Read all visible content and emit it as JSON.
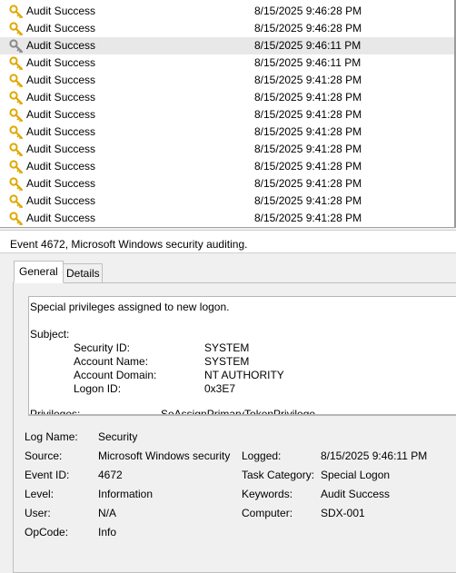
{
  "events": [
    {
      "keyword": "Audit Success",
      "datetime": "8/15/2025 9:46:28 PM"
    },
    {
      "keyword": "Audit Success",
      "datetime": "8/15/2025 9:46:28 PM"
    },
    {
      "keyword": "Audit Success",
      "datetime": "8/15/2025 9:46:11 PM",
      "selected": true
    },
    {
      "keyword": "Audit Success",
      "datetime": "8/15/2025 9:46:11 PM"
    },
    {
      "keyword": "Audit Success",
      "datetime": "8/15/2025 9:41:28 PM"
    },
    {
      "keyword": "Audit Success",
      "datetime": "8/15/2025 9:41:28 PM"
    },
    {
      "keyword": "Audit Success",
      "datetime": "8/15/2025 9:41:28 PM"
    },
    {
      "keyword": "Audit Success",
      "datetime": "8/15/2025 9:41:28 PM"
    },
    {
      "keyword": "Audit Success",
      "datetime": "8/15/2025 9:41:28 PM"
    },
    {
      "keyword": "Audit Success",
      "datetime": "8/15/2025 9:41:28 PM"
    },
    {
      "keyword": "Audit Success",
      "datetime": "8/15/2025 9:41:28 PM"
    },
    {
      "keyword": "Audit Success",
      "datetime": "8/15/2025 9:41:28 PM"
    },
    {
      "keyword": "Audit Success",
      "datetime": "8/15/2025 9:41:28 PM"
    }
  ],
  "details": {
    "title": "Event 4672, Microsoft Windows security auditing.",
    "tabs": {
      "general": "General",
      "details": "Details"
    },
    "message": {
      "heading": "Special privileges assigned to new logon.",
      "subject_label": "Subject:",
      "subject_fields": [
        {
          "label": "Security ID:",
          "value": "SYSTEM"
        },
        {
          "label": "Account Name:",
          "value": "SYSTEM"
        },
        {
          "label": "Account Domain:",
          "value": "NT AUTHORITY"
        },
        {
          "label": "Logon ID:",
          "value": "0x3E7"
        }
      ],
      "privileges_label": "Privileges:",
      "privileges_value": "SeAssignPrimaryTokenPrivilege"
    },
    "fields": {
      "log_name": {
        "label": "Log Name:",
        "value": "Security"
      },
      "source": {
        "label": "Source:",
        "value": "Microsoft Windows security"
      },
      "logged": {
        "label": "Logged:",
        "value": "8/15/2025 9:46:11 PM"
      },
      "event_id": {
        "label": "Event ID:",
        "value": "4672"
      },
      "task_category": {
        "label": "Task Category:",
        "value": "Special Logon"
      },
      "level": {
        "label": "Level:",
        "value": "Information"
      },
      "keywords": {
        "label": "Keywords:",
        "value": "Audit Success"
      },
      "user": {
        "label": "User:",
        "value": "N/A"
      },
      "computer": {
        "label": "Computer:",
        "value": "SDX-001"
      },
      "opcode": {
        "label": "OpCode:",
        "value": "Info"
      }
    }
  },
  "colors": {
    "key_gold": "#e0a800",
    "key_gray": "#8a8a8a",
    "selected_row": "#e8e8e8"
  },
  "icons": {
    "event_row": "key-icon"
  }
}
